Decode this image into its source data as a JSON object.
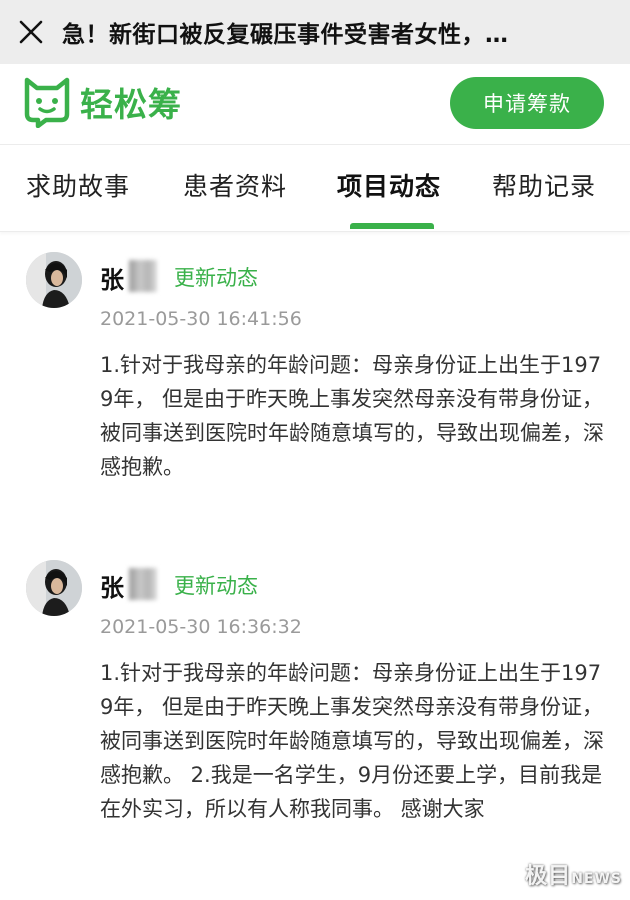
{
  "window": {
    "title": "急！新街口被反复碾压事件受害者女性，…",
    "close_icon": "close-icon"
  },
  "brand": {
    "name": "轻松筹",
    "logo_icon": "cat-logo-icon",
    "apply_label": "申请筹款",
    "color": "#3ab14a"
  },
  "tabs": [
    {
      "label": "求助故事",
      "active": false
    },
    {
      "label": "患者资料",
      "active": false
    },
    {
      "label": "项目动态",
      "active": true
    },
    {
      "label": "帮助记录",
      "active": false
    }
  ],
  "updates": [
    {
      "author": "张",
      "tag": "更新动态",
      "timestamp": "2021-05-30 16:41:56",
      "content": "1.针对于我母亲的年龄问题：母亲身份证上出生于1979年， 但是由于昨天晚上事发突然母亲没有带身份证，被同事送到医院时年龄随意填写的，导致出现偏差，深感抱歉。"
    },
    {
      "author": "张",
      "tag": "更新动态",
      "timestamp": "2021-05-30 16:36:32",
      "content": "1.针对于我母亲的年龄问题：母亲身份证上出生于1979年， 但是由于昨天晚上事发突然母亲没有带身份证，被同事送到医院时年龄随意填写的，导致出现偏差，深感抱歉。 2.我是一名学生，9月份还要上学，目前我是在外实习，所以有人称我同事。 感谢大家"
    }
  ],
  "watermark": {
    "cn": "极目",
    "en": "NEWS"
  }
}
